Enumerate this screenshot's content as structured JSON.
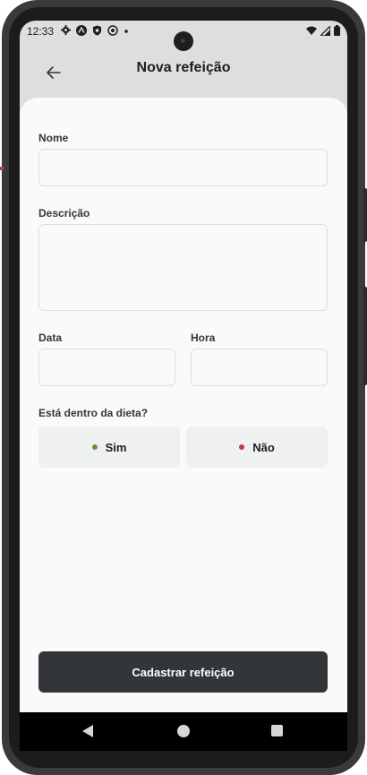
{
  "status_bar": {
    "time": "12:33",
    "icons": [
      "gear-icon",
      "app-icon",
      "shield-icon",
      "sync-icon",
      "dot-icon"
    ],
    "right_icons": [
      "wifi-icon",
      "signal-icon",
      "battery-icon"
    ]
  },
  "header": {
    "title": "Nova refeição",
    "back_icon": "arrow-left-icon"
  },
  "form": {
    "name_label": "Nome",
    "name_value": "",
    "description_label": "Descrição",
    "description_value": "",
    "date_label": "Data",
    "date_value": "",
    "time_label": "Hora",
    "time_value": "",
    "diet_question": "Está dentro da dieta?",
    "yes_label": "Sim",
    "no_label": "Não",
    "yes_dot_color": "#639339",
    "no_dot_color": "#bf3b44"
  },
  "submit_label": "Cadastrar refeição",
  "colors": {
    "primary_dark": "#333638",
    "background": "#fafafa",
    "header_bg": "#dddedf"
  }
}
